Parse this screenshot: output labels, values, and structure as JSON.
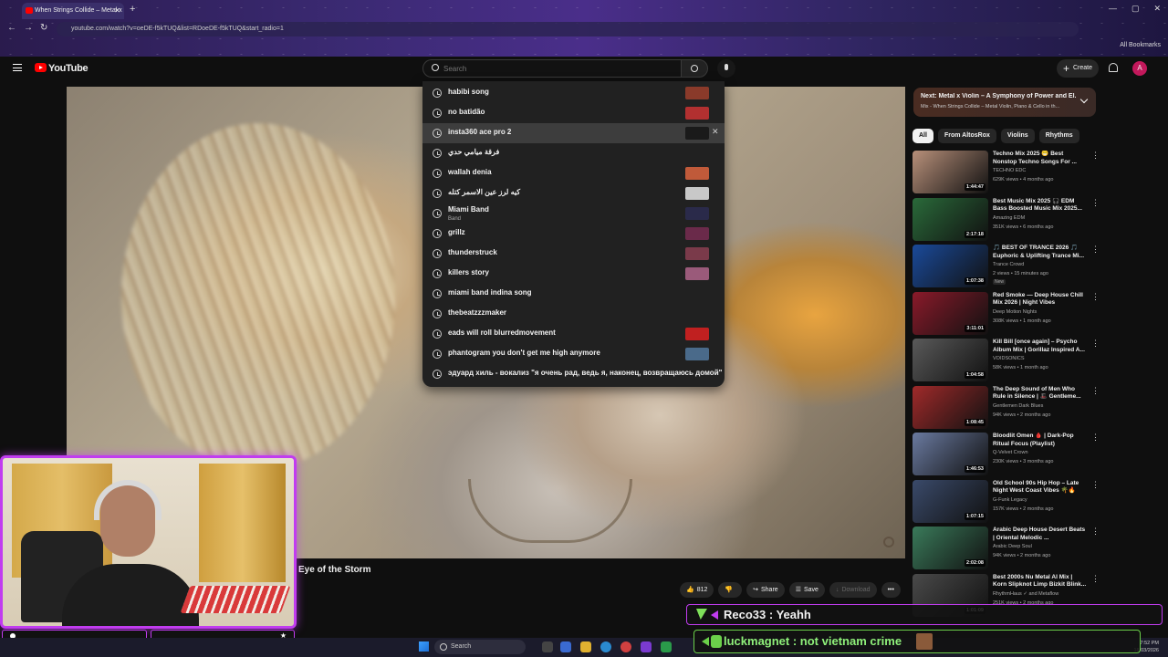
{
  "browser": {
    "tab_title": "When Strings Collide – Metal x",
    "url": "youtube.com/watch?v=oeDE-f5kTUQ&list=RDoeDE-f5kTUQ&start_radio=1",
    "all_bookmarks": "All Bookmarks"
  },
  "header": {
    "wordmark": "YouTube",
    "search_placeholder": "Search",
    "create_label": "Create",
    "avatar_letter": "A"
  },
  "suggestions": [
    {
      "text": "habibi song",
      "thumb": "#8a3a2a"
    },
    {
      "text": "no batidão",
      "thumb": "#b23030"
    },
    {
      "text": "insta360 ace pro 2",
      "thumb": "#1a1a1a",
      "active": true
    },
    {
      "text": "فرقة ميامي حدي",
      "thumb": ""
    },
    {
      "text": "wallah denia",
      "thumb": "#c05a3a"
    },
    {
      "text": "كيه لرز عين الاسمر كتله",
      "thumb": "#c8c8c8"
    },
    {
      "text": "Miami Band",
      "sub": "Band",
      "thumb": "#2a2a4a"
    },
    {
      "text": "grillz",
      "thumb": "#6a2a4a"
    },
    {
      "text": "thunderstruck",
      "thumb": "#7a3a4a"
    },
    {
      "text": "killers story",
      "thumb": "#9a5a7a"
    },
    {
      "text": "miami band indina song",
      "thumb": ""
    },
    {
      "text": "thebeatzzzmaker",
      "thumb": ""
    },
    {
      "text": "eads will roll blurredmovement",
      "thumb": "#c02020"
    },
    {
      "text": "phantogram you don't get me high anymore",
      "thumb": "#4a6a8a"
    },
    {
      "text": "эдуард хиль - вокализ \"я очень рад, ведь я, наконец, возвращаюсь домой\"",
      "thumb": ""
    }
  ],
  "next_banner": {
    "title": "Next: Metal x Violin – A Symphony of Power and El...",
    "subtitle": "Mix - When Strings Collide – Metal Violin, Piano & Cello in th..."
  },
  "chips": [
    "All",
    "From AltosRox",
    "Violins",
    "Rhythms"
  ],
  "recommendations": [
    {
      "title": "Techno Mix 2025 😁 Best Nonstop Techno Songs For ...",
      "channel": "TECHNO EDC",
      "meta": "629K views • 4 months ago",
      "duration": "1:44:47",
      "color": "#b8907a"
    },
    {
      "title": "Best Music Mix 2025 🎧 EDM Bass Boosted Music Mix 2025...",
      "channel": "Amazing EDM",
      "meta": "351K views • 6 months ago",
      "duration": "2:17:18",
      "color": "#2a6a3a"
    },
    {
      "title": "🎵 BEST OF TRANCE 2026 🎵 Euphoric & Uplifting Trance Mi...",
      "channel": "Trance Crowd",
      "meta": "2 views • 15 minutes ago",
      "badge": "New",
      "duration": "1:07:38",
      "color": "#1a4a9a"
    },
    {
      "title": "Red Smoke — Deep House Chill Mix 2026 | Night Vibes",
      "channel": "Deep Motion Nights",
      "meta": "308K views • 1 month ago",
      "duration": "3:11:01",
      "color": "#8a1a2a"
    },
    {
      "title": "Kill Bill [once again] – Psycho Album Mix | Gorillaz Inspired A...",
      "channel": "VOIDSONICS",
      "meta": "58K views • 1 month ago",
      "duration": "1:04:58",
      "color": "#5a5a5a"
    },
    {
      "title": "The Deep Sound of Men Who Rule in Silence | 🎩 Gentleme...",
      "channel": "Gentlemen Dark Blues",
      "meta": "94K views • 2 months ago",
      "duration": "1:08:45",
      "color": "#a02a2a"
    },
    {
      "title": "Bloodlit Omen 🩸 | Dark-Pop Ritual Focus (Playlist)",
      "channel": "Q-Velvet Crown",
      "meta": "230K views • 3 months ago",
      "duration": "1:46:53",
      "color": "#6a7aa0"
    },
    {
      "title": "Old School 90s Hip Hop – Late Night West Coast Vibes 🌴🔥",
      "channel": "G-Funk Legacy",
      "meta": "157K views • 2 months ago",
      "duration": "1:07:15",
      "color": "#3a4a6a"
    },
    {
      "title": "Arabic Deep House Desert Beats | Oriental Melodic ...",
      "channel": "Arabic Deep Soul",
      "meta": "94K views • 2 months ago",
      "duration": "2:02:08",
      "color": "#3a7a5a"
    },
    {
      "title": "Best 2000s Nu Metal AI Mix | Korn Slipknot Limp Bizkit Blink...",
      "channel": "RhythmHaus ✓ and Metaflow",
      "meta": "251K views • 2 months ago",
      "duration": "1:01:09",
      "color": "#4a4a4a"
    }
  ],
  "video": {
    "title": "Eye of the Storm",
    "likes": "812",
    "share": "Share",
    "save": "Save",
    "download": "Download"
  },
  "chat": [
    {
      "text": "Reco33 : Yeahh"
    },
    {
      "text": "luckmagnet : not vietnam crime"
    }
  ],
  "taskbar": {
    "search": "Search",
    "time": "7:52 PM",
    "date": "18/03/2026"
  }
}
